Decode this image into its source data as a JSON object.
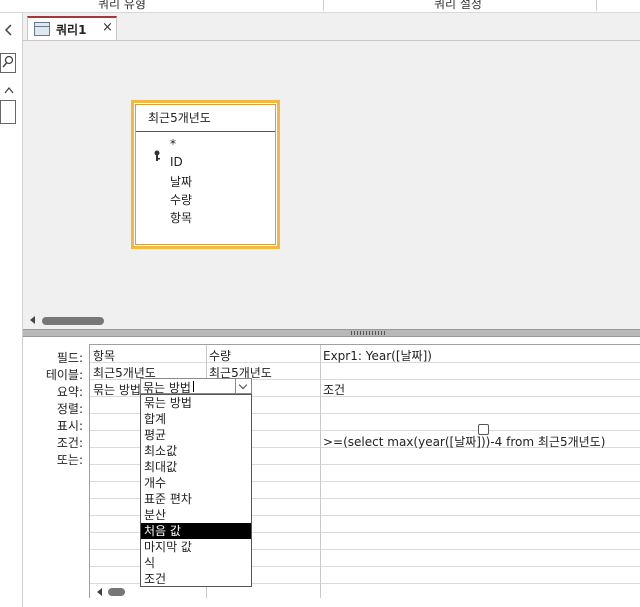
{
  "ribbon": {
    "left_label": "쿼리 유형",
    "right_label": "쿼리 설정"
  },
  "nav": {
    "back_icon": "chevron-left-icon",
    "search_icon": "search-icon",
    "up_icon": "chevron-up-icon"
  },
  "tab": {
    "title": "쿼리1",
    "close": "×"
  },
  "table_box": {
    "title": "최근5개년도",
    "fields": [
      "*",
      "ID",
      "날짜",
      "수량",
      "항목"
    ]
  },
  "grid": {
    "row_labels": [
      "필드:",
      "테이블:",
      "요약:",
      "정렬:",
      "표시:",
      "조건:",
      "또는:"
    ],
    "columns": [
      {
        "field": "항목",
        "table": "최근5개년도",
        "total": "묶는 방법",
        "show": true,
        "criteria": ""
      },
      {
        "field": "수량",
        "table": "최근5개년도",
        "total": "묶는 방법",
        "show": null,
        "criteria": ""
      },
      {
        "field": "Expr1: Year([날짜])",
        "table": "",
        "total": "조건",
        "show": false,
        "criteria": ">=(select max(year([날짜]))-4 from 최근5개년도)"
      }
    ]
  },
  "dropdown": {
    "options": [
      "묶는 방법",
      "합계",
      "평균",
      "최소값",
      "최대값",
      "개수",
      "표준 편차",
      "분산",
      "처음 값",
      "마지막 값",
      "식",
      "조건"
    ],
    "selected": "처음 값"
  },
  "colors": {
    "accent": "#a4373a",
    "table_border": "#f4b840",
    "checkbox": "#1a6dd0"
  }
}
